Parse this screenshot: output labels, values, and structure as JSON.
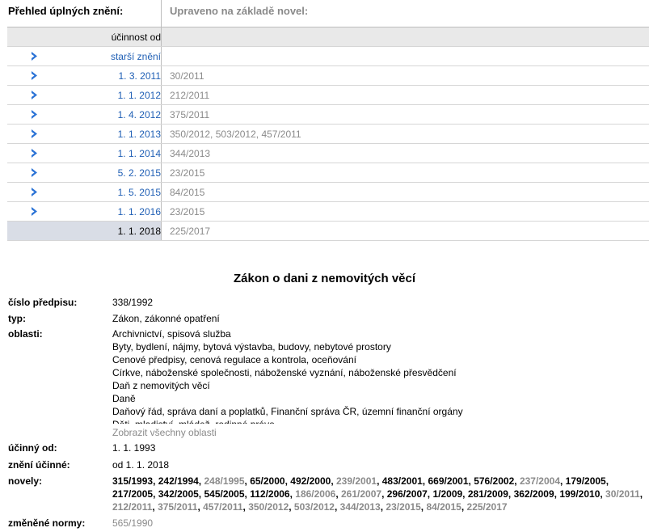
{
  "header": {
    "left_label": "Přehled úplných znění:",
    "right_label": "Upraveno na základě novel:"
  },
  "versions": {
    "col_label": "účinnost od",
    "older_label": "starší znění",
    "rows": [
      {
        "date": "1. 3. 2011",
        "amendments": "30/2011"
      },
      {
        "date": "1. 1. 2012",
        "amendments": "212/2011"
      },
      {
        "date": "1. 4. 2012",
        "amendments": "375/2011"
      },
      {
        "date": "1. 1. 2013",
        "amendments": "350/2012, 503/2012, 457/2011"
      },
      {
        "date": "1. 1. 2014",
        "amendments": "344/2013"
      },
      {
        "date": "5. 2. 2015",
        "amendments": "23/2015"
      },
      {
        "date": "1. 5. 2015",
        "amendments": "84/2015"
      },
      {
        "date": "1. 1. 2016",
        "amendments": "23/2015"
      }
    ],
    "current": {
      "date": "1. 1. 2018",
      "amendments": "225/2017"
    }
  },
  "law": {
    "title": "Zákon o dani z nemovitých věcí",
    "labels": {
      "number": "číslo předpisu:",
      "type": "typ:",
      "areas": "oblasti:",
      "effective": "účinný od:",
      "version": "znění účinné:",
      "novels": "novely:",
      "changed": "změněné normy:"
    },
    "number": "338/1992",
    "type": "Zákon, zákonné opatření",
    "areas": [
      "Archivnictví, spisová služba",
      "Byty, bydlení, nájmy, bytová výstavba, budovy, nebytové prostory",
      "Cenové předpisy, cenová regulace a kontrola, oceňování",
      "Církve, náboženské společnosti, náboženské vyznání, náboženské přesvědčení",
      "Daň z nemovitých věcí",
      "Daně",
      "Daňový řád, správa daní a poplatků, Finanční správa ČR, územní finanční orgány",
      "Děti, mladiství, mládež, rodinné právo"
    ],
    "show_all_areas": "Zobrazit všechny oblasti",
    "effective": "1. 1. 1993",
    "version": "od 1. 1. 2018",
    "novels": [
      {
        "t": "315/1993",
        "active": true
      },
      {
        "t": "242/1994",
        "active": true
      },
      {
        "t": "248/1995",
        "active": false
      },
      {
        "t": "65/2000",
        "active": true
      },
      {
        "t": "492/2000",
        "active": true
      },
      {
        "t": "239/2001",
        "active": false
      },
      {
        "t": "483/2001",
        "active": true
      },
      {
        "t": "669/2001",
        "active": true
      },
      {
        "t": "576/2002",
        "active": true
      },
      {
        "t": "237/2004",
        "active": false
      },
      {
        "t": "179/2005",
        "active": true
      },
      {
        "t": "217/2005",
        "active": true
      },
      {
        "t": "342/2005",
        "active": true
      },
      {
        "t": "545/2005",
        "active": true
      },
      {
        "t": "112/2006",
        "active": true
      },
      {
        "t": "186/2006",
        "active": false
      },
      {
        "t": "261/2007",
        "active": false
      },
      {
        "t": "296/2007",
        "active": true
      },
      {
        "t": "1/2009",
        "active": true
      },
      {
        "t": "281/2009",
        "active": true
      },
      {
        "t": "362/2009",
        "active": true
      },
      {
        "t": "199/2010",
        "active": true
      },
      {
        "t": "30/2011",
        "active": false
      },
      {
        "t": "212/2011",
        "active": false
      },
      {
        "t": "375/2011",
        "active": false
      },
      {
        "t": "457/2011",
        "active": false
      },
      {
        "t": "350/2012",
        "active": false
      },
      {
        "t": "503/2012",
        "active": false
      },
      {
        "t": "344/2013",
        "active": false
      },
      {
        "t": "23/2015",
        "active": false
      },
      {
        "t": "84/2015",
        "active": false
      },
      {
        "t": "225/2017",
        "active": false
      }
    ],
    "changed": "565/1990"
  }
}
